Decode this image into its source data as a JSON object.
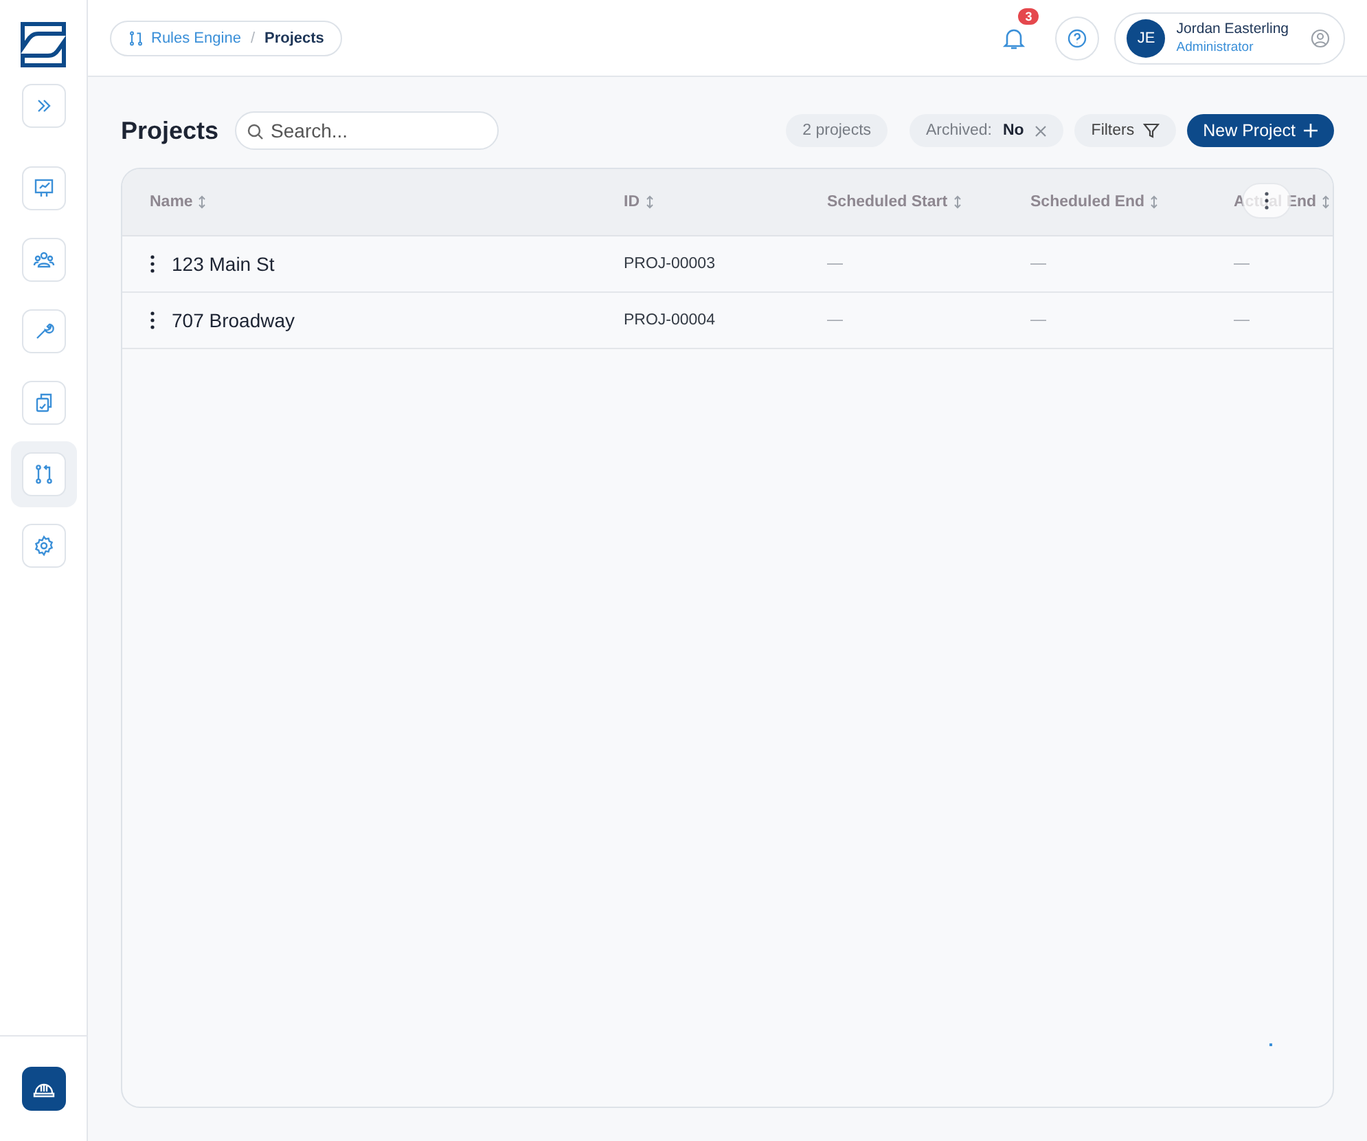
{
  "sidebar": {
    "items": [
      {
        "kind": "presentation",
        "selected": false
      },
      {
        "kind": "team",
        "selected": false
      },
      {
        "kind": "wrench",
        "selected": false
      },
      {
        "kind": "documents",
        "selected": false
      },
      {
        "kind": "rules",
        "selected": true
      },
      {
        "kind": "gear",
        "selected": false
      }
    ]
  },
  "breadcrumb": [
    {
      "label": "Rules Engine",
      "current": false
    },
    {
      "label": "Projects",
      "current": true
    }
  ],
  "breadcrumb_separator": "/",
  "header": {
    "notification_count": "3",
    "user": {
      "initials": "JE",
      "name": "Jordan Easterling",
      "role": "Administrator"
    }
  },
  "page": {
    "title": "Projects",
    "search": {
      "placeholder": "Search..."
    },
    "count": "2 projects",
    "filter_chip": {
      "label": "Archived:",
      "value": "No"
    },
    "filters_button": "Filters",
    "new_button": "New Project"
  },
  "table": {
    "columns": [
      {
        "label": "Name"
      },
      {
        "label": "ID"
      },
      {
        "label": "Scheduled Start"
      },
      {
        "label": "Scheduled End"
      },
      {
        "label": "Actual End"
      }
    ],
    "rows": [
      {
        "cells": [
          "123 Main St",
          "PROJ-00003",
          "—",
          "—",
          "—"
        ]
      },
      {
        "cells": [
          "707 Broadway",
          "PROJ-00004",
          "—",
          "—",
          "—"
        ]
      }
    ]
  }
}
